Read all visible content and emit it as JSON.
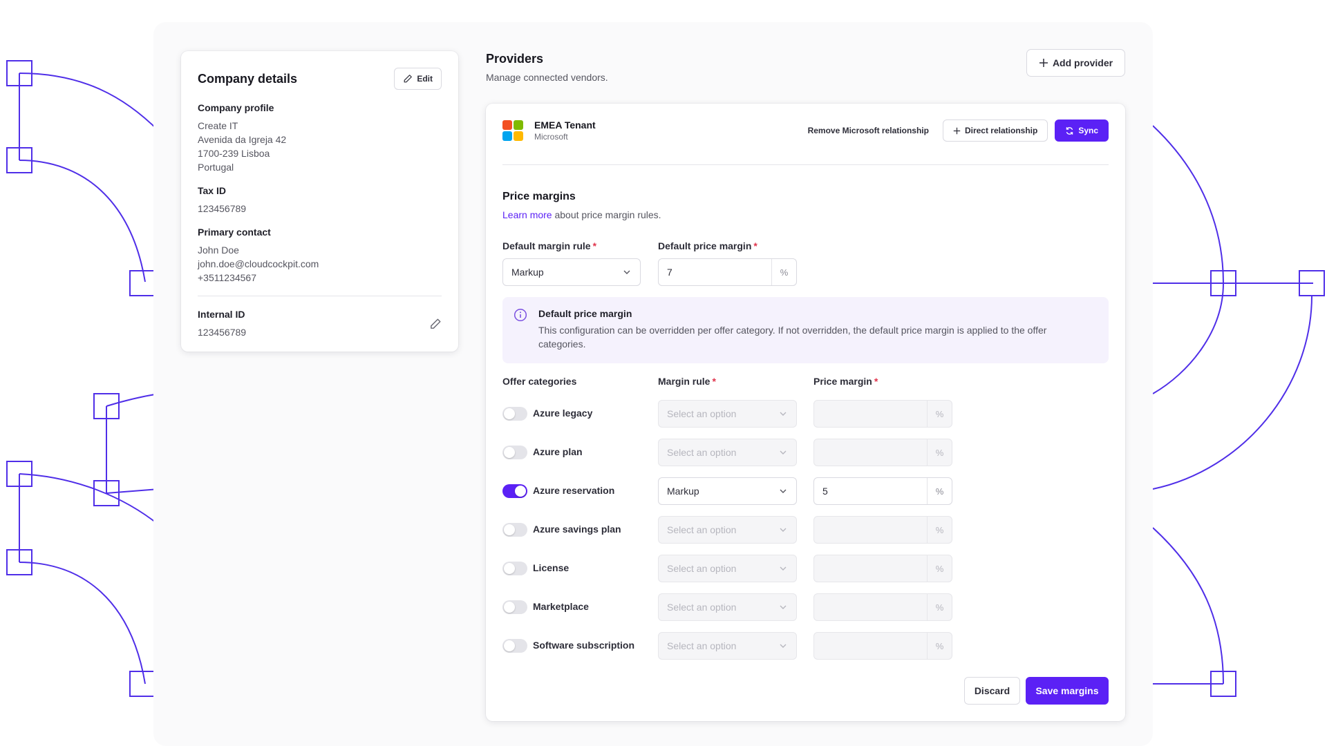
{
  "company": {
    "title": "Company details",
    "edit_label": "Edit",
    "profile_label": "Company profile",
    "profile_lines": [
      "Create IT",
      "Avenida da Igreja 42",
      "1700-239 Lisboa",
      "Portugal"
    ],
    "tax_label": "Tax ID",
    "tax_value": "123456789",
    "contact_label": "Primary contact",
    "contact_lines": [
      "John Doe",
      "john.doe@cloudcockpit.com",
      "+3511234567"
    ],
    "internal_label": "Internal ID",
    "internal_value": "123456789"
  },
  "providers": {
    "title": "Providers",
    "subtitle": "Manage connected vendors.",
    "add_label": "Add provider"
  },
  "tenant": {
    "name": "EMEA Tenant",
    "vendor": "Microsoft",
    "remove_label": "Remove Microsoft relationship",
    "direct_label": "Direct relationship",
    "sync_label": "Sync",
    "logo_colors": [
      "#f25022",
      "#7fba00",
      "#00a4ef",
      "#ffb900"
    ]
  },
  "margins": {
    "title": "Price margins",
    "learn_more": "Learn more",
    "subtitle_rest": " about price margin rules.",
    "default_rule_label": "Default margin rule",
    "default_rule_value": "Markup",
    "default_margin_label": "Default price margin",
    "default_margin_value": "7",
    "unit": "%",
    "required_mark": "*",
    "info_title": "Default price margin",
    "info_text": "This configuration can be overridden per offer category. If not overridden, the default price margin is applied to the offer categories.",
    "col_categories": "Offer categories",
    "col_rule": "Margin rule",
    "col_margin": "Price margin",
    "placeholder": "Select an option",
    "categories": [
      {
        "label": "Azure legacy",
        "enabled": false,
        "rule": "",
        "margin": ""
      },
      {
        "label": "Azure plan",
        "enabled": false,
        "rule": "",
        "margin": ""
      },
      {
        "label": "Azure reservation",
        "enabled": true,
        "rule": "Markup",
        "margin": "5"
      },
      {
        "label": "Azure savings plan",
        "enabled": false,
        "rule": "",
        "margin": ""
      },
      {
        "label": "License",
        "enabled": false,
        "rule": "",
        "margin": ""
      },
      {
        "label": "Marketplace",
        "enabled": false,
        "rule": "",
        "margin": ""
      },
      {
        "label": "Software subscription",
        "enabled": false,
        "rule": "",
        "margin": ""
      }
    ],
    "discard_label": "Discard",
    "save_label": "Save margins"
  },
  "colors": {
    "accent": "#5b21f5",
    "decoration": "#4f2ee8"
  }
}
